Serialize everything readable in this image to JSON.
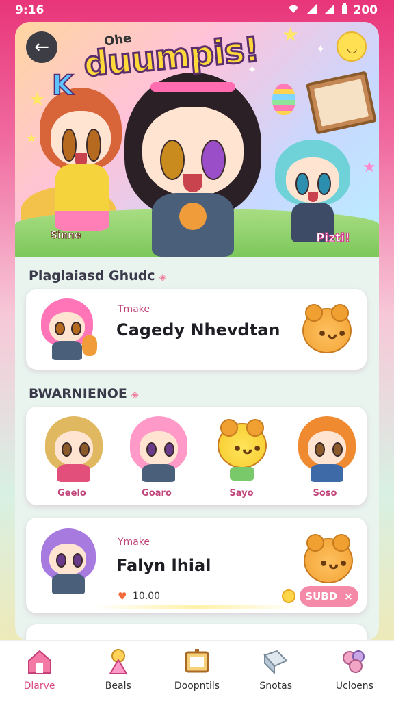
{
  "status_bar": {
    "time": "9:16",
    "right_text": "200"
  },
  "hero": {
    "title_small": "Ohe",
    "title": "duumpis!",
    "title_letter": "K",
    "label_left": "Sinne",
    "label_right": "Pizti!"
  },
  "sections": {
    "first_title": "Plaglaiasd Ghudc",
    "second_title": "BWARNIENOE"
  },
  "featured_row": {
    "subtitle": "Tmake",
    "name": "Cagedy Nhevdtan"
  },
  "favorites": {
    "items": [
      {
        "label": "Geelo"
      },
      {
        "label": "Goaro"
      },
      {
        "label": "Sayo"
      },
      {
        "label": "Soso"
      }
    ]
  },
  "second_row": {
    "subtitle": "Ymake",
    "name": "Falyn lhial",
    "count": "10.00",
    "subscribe_label": "SUBD",
    "subscribe_close": "×"
  },
  "tabbar": {
    "items": [
      {
        "label": "Dlarve",
        "active": true
      },
      {
        "label": "Beals",
        "active": false
      },
      {
        "label": "Doopntils",
        "active": false
      },
      {
        "label": "Snotas",
        "active": false
      },
      {
        "label": "Ucloens",
        "active": false
      }
    ]
  },
  "colors": {
    "accent_pink": "#d94a85",
    "status_bar": "#e8357a",
    "panel_bg": "#ffffff",
    "bear_orange": "#f0a030"
  },
  "icons": {
    "back": "arrow-left-icon",
    "status": [
      "wifi-icon",
      "signal-icon",
      "battery-icon"
    ],
    "tabbar": [
      "home-icon",
      "character-icon",
      "frame-icon",
      "book-icon",
      "flower-icon"
    ]
  }
}
